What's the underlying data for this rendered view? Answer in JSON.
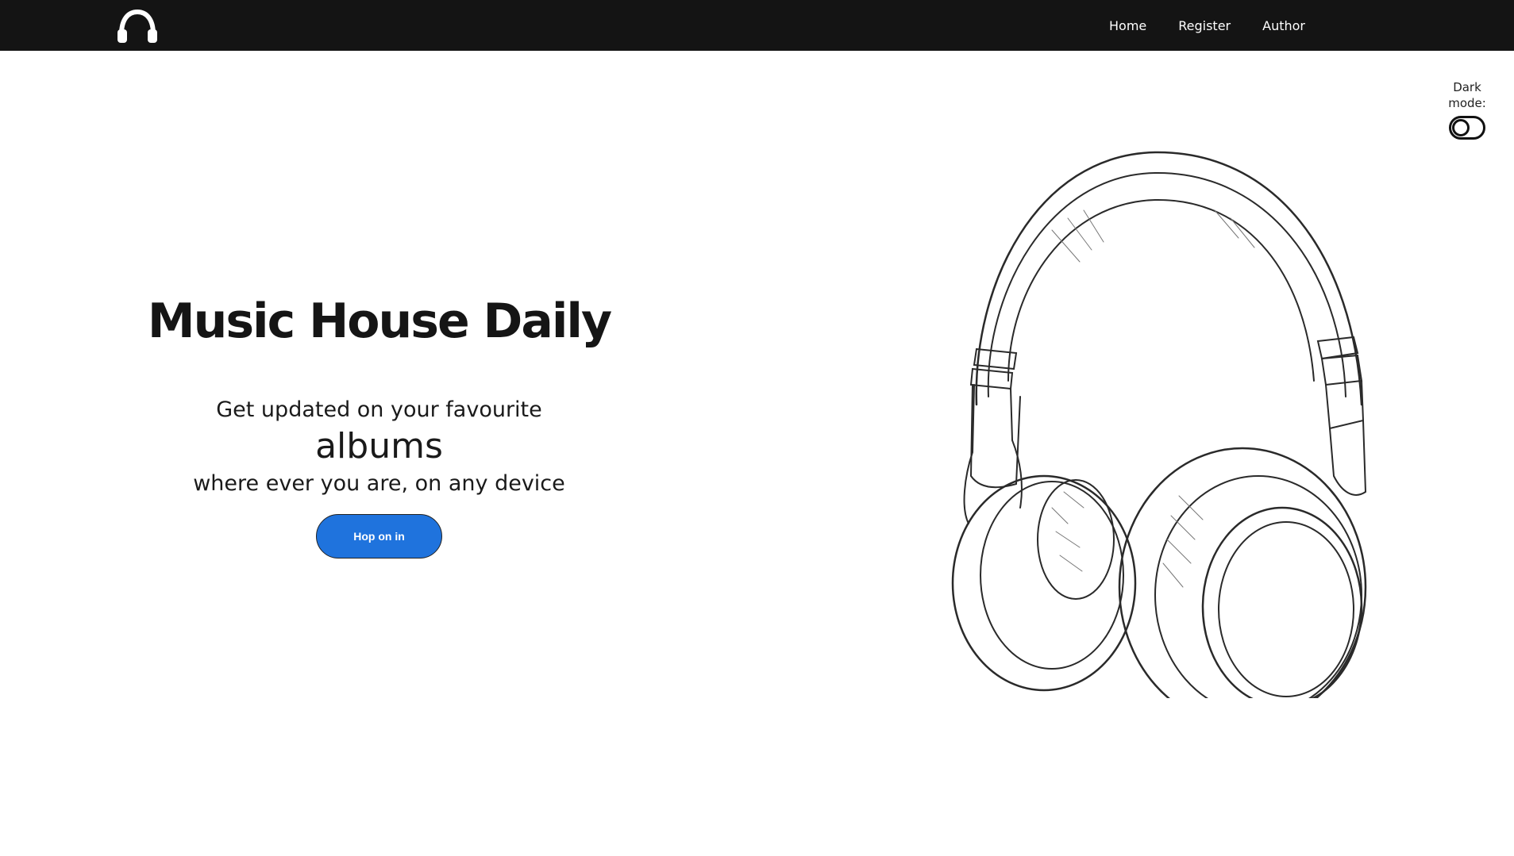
{
  "nav": {
    "logo_icon": "headphones-icon",
    "links": [
      {
        "label": "Home"
      },
      {
        "label": "Register"
      },
      {
        "label": "Author"
      }
    ]
  },
  "dark_mode": {
    "label": "Dark mode:",
    "enabled": false
  },
  "hero": {
    "title": "Music House Daily",
    "line1": "Get updated on your favourite",
    "line2": "albums",
    "line3": "where ever you are, on any device",
    "cta_label": "Hop on in",
    "cta_color": "#1f73dd"
  },
  "illustration": {
    "icon": "headphones-sketch"
  }
}
